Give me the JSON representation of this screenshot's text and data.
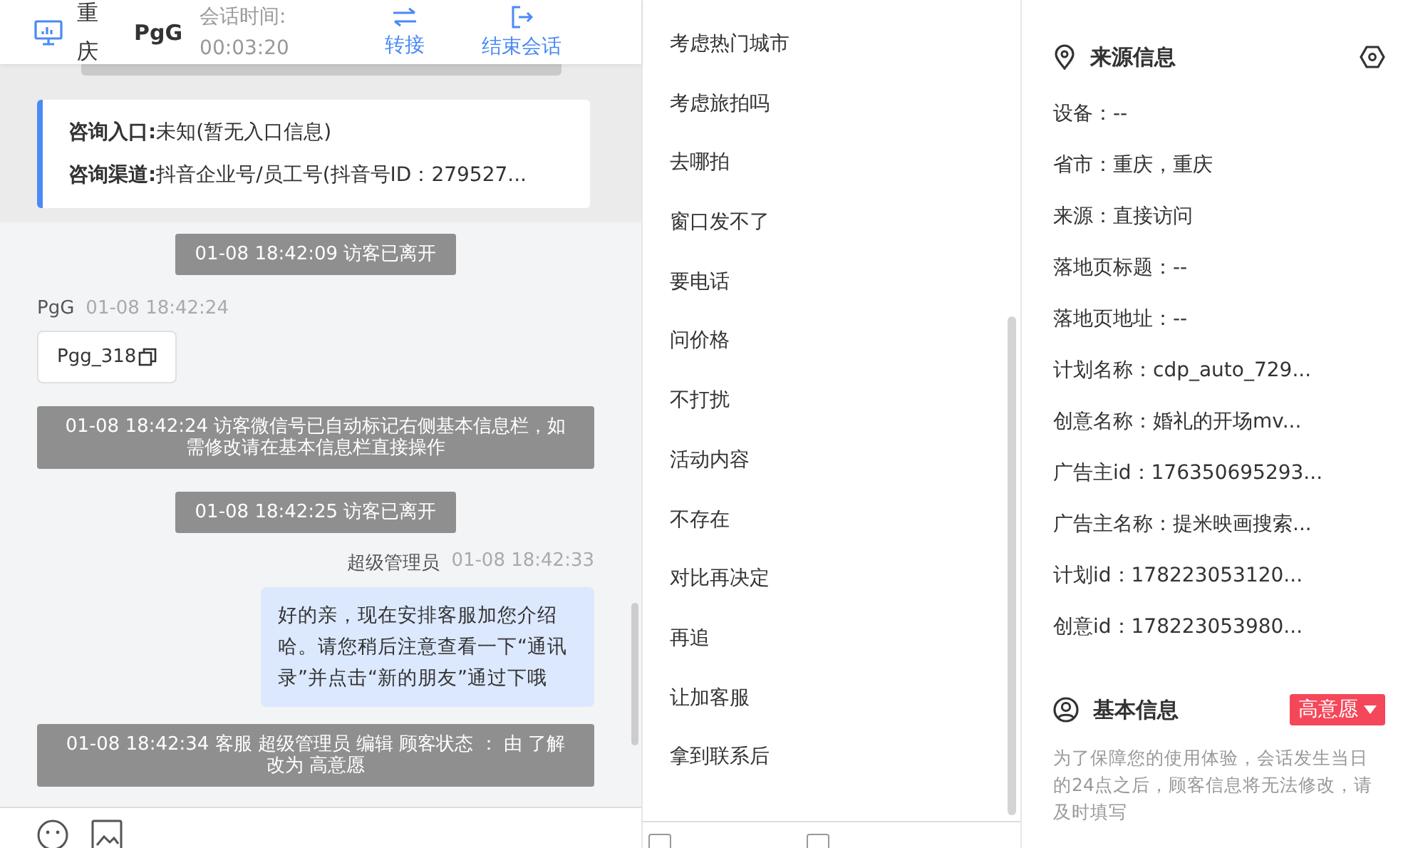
{
  "header": {
    "city": "重庆",
    "visitor": "PgG",
    "session_label": "会话时间:",
    "session_time": "00:03:20",
    "actions": [
      {
        "label": "转接",
        "kind": "transfer"
      },
      {
        "label": "结束会话",
        "kind": "end"
      }
    ]
  },
  "consult_card": [
    {
      "label": "咨询入口:",
      "value": "未知(暂无入口信息)"
    },
    {
      "label": "咨询渠道:",
      "value": "抖音企业号/员工号(抖音号ID：279527..."
    }
  ],
  "messages": [
    {
      "kind": "system",
      "text": "01-08 18:42:09 访客已离开"
    },
    {
      "kind": "visitor",
      "sender": "PgG",
      "time": "01-08 18:42:24",
      "text": "Pgg_318"
    },
    {
      "kind": "system",
      "text": "01-08 18:42:24 访客微信号已自动标记右侧基本信息栏，如需修改请在基本信息栏直接操作"
    },
    {
      "kind": "system",
      "text": "01-08 18:42:25 访客已离开"
    },
    {
      "kind": "agent",
      "sender": "超级管理员",
      "time": "01-08 18:42:33",
      "text": "好的亲，现在安排客服加您介绍哈。请您稍后注意查看一下“通讯录”并点击“新的朋友”通过下哦"
    },
    {
      "kind": "system",
      "text": "01-08 18:42:34 客服 超级管理员 编辑 顾客状态 ： 由 了解改为 高意愿"
    }
  ],
  "quick_replies": [
    "考虑热门城市",
    "考虑旅拍吗",
    "去哪拍",
    "窗口发不了",
    "要电话",
    "问价格",
    "不打扰",
    "活动内容",
    "不存在",
    "对比再决定",
    "再追",
    "让加客服",
    "拿到联系后"
  ],
  "bottom_checkboxes": [
    {
      "checked": false
    },
    {
      "checked": false
    }
  ],
  "source_info": {
    "title": "来源信息",
    "fields": [
      "设备：--",
      "省市：重庆，重庆",
      "来源：直接访问",
      "落地页标题：--",
      "落地页地址：--",
      "计划名称：cdp_auto_729...",
      "创意名称：婚礼的开场mv...",
      "广告主id：176350695293...",
      "广告主名称：提米映画搜索...",
      "计划id：178223053120...",
      "创意id：178223053980..."
    ]
  },
  "basic_info": {
    "title": "基本信息",
    "status": "高意愿",
    "notice": "为了保障您的使用体验，会话发生当日的24点之后，顾客信息将无法修改，请及时填写"
  }
}
